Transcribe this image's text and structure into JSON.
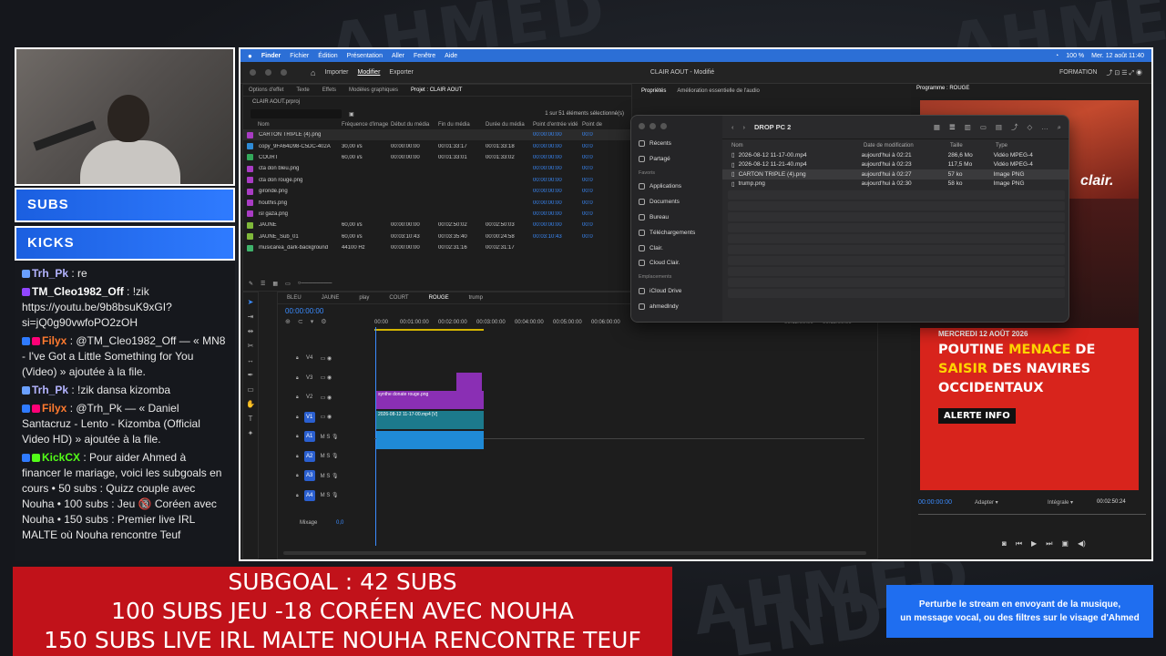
{
  "webcam": {},
  "sidebar": {
    "subs_label": "SUBS",
    "kicks_label": "KICKS"
  },
  "chat": [
    {
      "user": "Trh_Pk",
      "sep": " : ",
      "text": "re",
      "color": "#b4b4ff"
    },
    {
      "user": "TM_Cleo1982_Off",
      "sep": " : ",
      "text": "!zik https://youtu.be/9b8bsuK9xGI?si=jQ0g90vwfoPO2zOH",
      "color": "#ffffff"
    },
    {
      "user": "Filyx",
      "sep": " : ",
      "text": "@TM_Cleo1982_Off — « MN8 - I've Got a Little Something for You (Video) » ajoutée à la file.",
      "color": "#ff7a2f"
    },
    {
      "user": "Trh_Pk",
      "sep": " : ",
      "text": "!zik dansa kizomba",
      "color": "#b4b4ff"
    },
    {
      "user": "Filyx",
      "sep": " : ",
      "text": "@Trh_Pk — « Daniel Santacruz - Lento - Kizomba (Official Video HD) » ajoutée à la file.",
      "color": "#ff7a2f"
    },
    {
      "user": "KickCX",
      "sep": " : ",
      "text": "Pour aider Ahmed à financer le mariage, voici les subgoals en cours • 50 subs : Quizz couple avec Nouha • 100 subs : Jeu 🔞 Coréen avec Nouha • 150 subs : Premier live IRL MALTE où Nouha rencontre Teuf",
      "color": "#53fc18"
    }
  ],
  "menubar": {
    "app": "Finder",
    "items": [
      "Fichier",
      "Édition",
      "Présentation",
      "Aller",
      "Fenêtre",
      "Aide"
    ],
    "battery": "100 %",
    "datetime": "Mer. 12 août  11:40"
  },
  "premiere": {
    "workspaces": [
      "Importer",
      "Modifier",
      "Exporter"
    ],
    "title": "CLAIR AOUT - Modifié",
    "formation": "FORMATION",
    "project_tabs": [
      "Options d'effet",
      "Texte",
      "Effets",
      "Modèles graphiques",
      "Projet : CLAIR AOUT"
    ],
    "project_file": "CLAIR AOUT.prproj",
    "items_selected": "1 sur 51 éléments sélectionné(s)",
    "columns": [
      "Nom",
      "Fréquence d'image",
      "Début du média",
      "Fin du média",
      "Durée du média",
      "Point d'entrée vidé",
      "Point de"
    ],
    "files": [
      {
        "name": "CARTON TRIPLE (4).png",
        "fps": "",
        "start": "",
        "end": "",
        "dur": "",
        "in": "00:00:00:00",
        "pt": "00:0",
        "color": "#a93cc4"
      },
      {
        "name": "copy_9FA64D98-C5DC-402A",
        "fps": "30,00 i/s",
        "start": "00:00:00:00",
        "end": "00:01:33:17",
        "dur": "00:01:33:18",
        "in": "00:00:00:00",
        "pt": "00:0",
        "color": "#2e8bd6"
      },
      {
        "name": "COURT",
        "fps": "60,00 i/s",
        "start": "00:00:00:00",
        "end": "00:01:33:01",
        "dur": "00:01:33:02",
        "in": "00:00:00:00",
        "pt": "00:0",
        "color": "#33a85a"
      },
      {
        "name": "cta don bleu.png",
        "fps": "",
        "start": "",
        "end": "",
        "dur": "",
        "in": "00:00:00:00",
        "pt": "00:0",
        "color": "#a93cc4"
      },
      {
        "name": "cta don rouge.png",
        "fps": "",
        "start": "",
        "end": "",
        "dur": "",
        "in": "00:00:00:00",
        "pt": "00:0",
        "color": "#a93cc4"
      },
      {
        "name": "gironde.png",
        "fps": "",
        "start": "",
        "end": "",
        "dur": "",
        "in": "00:00:00:00",
        "pt": "00:0",
        "color": "#a93cc4"
      },
      {
        "name": "houthis.png",
        "fps": "",
        "start": "",
        "end": "",
        "dur": "",
        "in": "00:00:00:00",
        "pt": "00:0",
        "color": "#a93cc4"
      },
      {
        "name": "isl gaza.png",
        "fps": "",
        "start": "",
        "end": "",
        "dur": "",
        "in": "00:00:00:00",
        "pt": "00:0",
        "color": "#a93cc4"
      },
      {
        "name": "JAUNE",
        "fps": "60,00 i/s",
        "start": "00:00:00:00",
        "end": "00:02:50:02",
        "dur": "00:02:50:03",
        "in": "00:00:00:00",
        "pt": "00:0",
        "color": "#7fb83a"
      },
      {
        "name": "JAUNE_Sub_01",
        "fps": "60,00 i/s",
        "start": "00:03:10:43",
        "end": "00:03:35:40",
        "dur": "00:00:24:58",
        "in": "00:03:10:43",
        "pt": "00:0",
        "color": "#7fb83a"
      },
      {
        "name": "musicarea_dark-background",
        "fps": "44100  Hz",
        "start": "00:00:00:00",
        "end": "00:02:31:16",
        "dur": "00:02:31:17",
        "in": "",
        "pt": "",
        "color": "#3fb36b"
      }
    ],
    "props_tabs": [
      "Propriétés",
      "Amélioration essentielle de l'audio"
    ],
    "seq_tabs": [
      "BLEU",
      "JAUNE",
      "play",
      "COURT",
      "ROUGE",
      "trump"
    ],
    "timecode": "00:00:00:00",
    "ruler": [
      "00:00",
      "00:01:00:00",
      "00:02:00:00",
      "00:03:00:00",
      "00:04:00:00",
      "00:05:00:00",
      "00:06:00:00",
      "00:12:00:00",
      "00:13:00:00"
    ],
    "tracks_v": [
      "V4",
      "V3",
      "V2",
      "V1"
    ],
    "tracks_a": [
      "A1",
      "A2",
      "A3",
      "A4"
    ],
    "mix_label": "Mixage",
    "mix_value": "0,0",
    "clip_v2": "synthe donate rouge.png",
    "clip_v1": "2026-08-12 11-17-00.mp4 [V]",
    "program_title": "Programme : ROUGE",
    "program_tc": "00:00:00:00",
    "program_fit": "Adapter",
    "program_quality": "Intégrale",
    "program_dur": "00:02:50:24"
  },
  "thumbnail": {
    "brand": "clair.",
    "date": "MERCREDI 12 AOÛT 2026",
    "line1a": "POUTINE ",
    "line1b": "MENACE",
    "line1c": " DE",
    "line2a": "SAISIR",
    "line2b": " DES NAVIRES",
    "line3": "OCCIDENTAUX",
    "tag": "ALERTE INFO"
  },
  "finder": {
    "title": "DROP PC 2",
    "sidebar": [
      "Récents",
      "Partagé"
    ],
    "fav_label": "Favoris",
    "favorites": [
      "Applications",
      "Documents",
      "Bureau",
      "Téléchargements",
      "Clair.",
      "Cloud Clair."
    ],
    "loc_label": "Emplacements",
    "locations": [
      "iCloud Drive",
      "ahmedlndy"
    ],
    "columns": [
      "Nom",
      "Date de modification",
      "Taille",
      "Type"
    ],
    "files": [
      {
        "name": "2026-08-12 11-17-00.mp4",
        "date": "aujourd'hui à 02:21",
        "size": "286,6 Mo",
        "type": "Vidéo MPEG-4"
      },
      {
        "name": "2026-08-12 11-21-40.mp4",
        "date": "aujourd'hui à 02:23",
        "size": "117,5 Mo",
        "type": "Vidéo MPEG-4"
      },
      {
        "name": "CARTON TRIPLE (4).png",
        "date": "aujourd'hui à 02:27",
        "size": "57 ko",
        "type": "Image PNG"
      },
      {
        "name": "trump.png",
        "date": "aujourd'hui à 02:30",
        "size": "58 ko",
        "type": "Image PNG"
      }
    ]
  },
  "subgoal": {
    "line1": "SUBGOAL : 42 SUBS",
    "line2": "100 SUBS JEU -18 CORÉEN AVEC NOUHA",
    "line3": "150 SUBS LIVE IRL MALTE NOUHA RENCONTRE TEUF"
  },
  "cta": {
    "line1": "Perturbe le stream en envoyant de la musique,",
    "line2": "un message vocal, ou des filtres sur le visage d'Ahmed"
  },
  "bg_text": [
    "AHMED",
    "LNDY"
  ]
}
